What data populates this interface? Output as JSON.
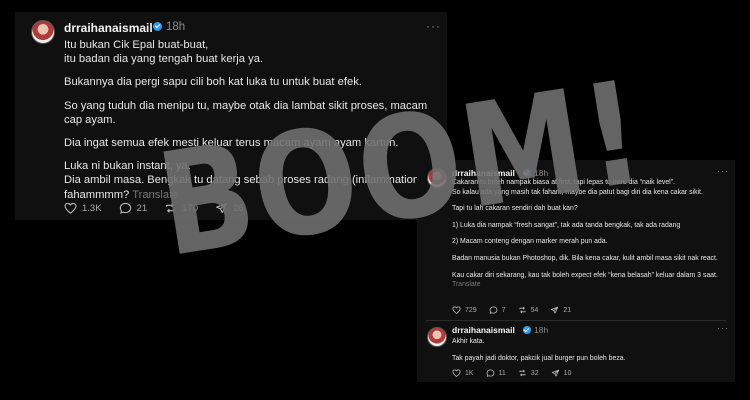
{
  "main_post": {
    "username": "drraihanaismail",
    "time": "18h",
    "more_label": "···",
    "paragraphs": [
      "Itu bukan Cik Epal buat-buat,\nitu badan dia yang tengah buat kerja ya.",
      "Bukannya dia pergi sapu cili boh kat luka tu untuk buat efek.",
      "So yang tuduh dia menipu tu, maybe otak dia lambat sikit proses, macam cap ayam.",
      "Dia ingat semua efek mesti keluar terus macam ayam ayam kartun."
    ],
    "last_paragraph": "Luka ni bukan instant, ya.\nDia ambil masa. Bengkak tu datang sebab proses radang (inflammation), fahammmm?",
    "translate": "Translate",
    "counts": {
      "likes": "1.3K",
      "replies": "21",
      "reposts": "170",
      "shares": "26"
    }
  },
  "side_post": {
    "username": "drraihanaismail",
    "time": "18h",
    "more_label": "···",
    "paragraphs": [
      "Cakaran tu boleh nampak biasa at first, tapi lepas tu baru dia “naik level”.\nSo kalau ada yang masih tak faham, maybe dia patut bagi diri dia kena cakar sikit.",
      "Tapi tu lah cakaran sendiri dah buat kan?",
      "1) Luka dia nampak “fresh sangat”, tak ada tanda bengkak, tak ada radang",
      "2) Macam conteng dengan marker merah pun ada.",
      "Badan manusia bukan Photoshop, dik. Bila kena cakar, kulit ambil masa sikit nak react."
    ],
    "last_paragraph": "Kau cakar diri sekarang, kau tak boleh expect efek “kena belasah” keluar dalam 3 saat.",
    "translate": "Translate",
    "counts": {
      "likes": "729",
      "replies": "7",
      "reposts": "54",
      "shares": "21"
    }
  },
  "reply_post": {
    "username": "drraihanaismail",
    "time": "18h",
    "more_label": "···",
    "paragraphs": [
      "Akhir kata.",
      "Tak payah jadi doktor, pakcik jual burger pun boleh beza."
    ],
    "counts": {
      "likes": "1K",
      "replies": "11",
      "reposts": "32",
      "shares": "10"
    }
  },
  "watermark": "BOOM!",
  "colors": {
    "background": "#000000",
    "panel": "#101010",
    "text": "#e7e7e7",
    "muted": "#8b8b8b",
    "verified": "#2f9bf0",
    "watermark": "#7a7a7a"
  },
  "icons": [
    "verified-badge-icon",
    "more-icon",
    "heart-icon",
    "reply-icon",
    "repost-icon",
    "share-icon"
  ]
}
